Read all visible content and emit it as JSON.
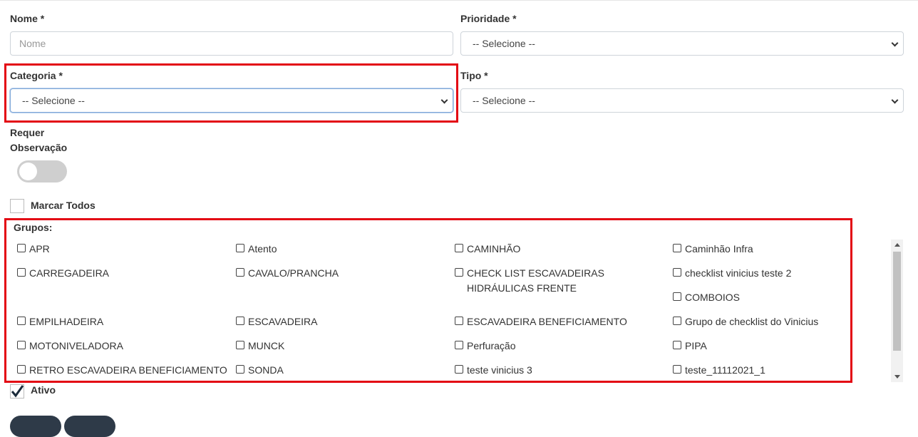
{
  "form": {
    "nome_label": "Nome *",
    "nome_placeholder": "Nome",
    "prioridade_label": "Prioridade *",
    "prioridade_value": "-- Selecione --",
    "categoria_label": "Categoria *",
    "categoria_value": "-- Selecione --",
    "tipo_label": "Tipo *",
    "tipo_value": "-- Selecione --",
    "requer_label_line1": "Requer",
    "requer_label_line2": "Observação",
    "requer_observacao_on": false,
    "marcar_todos_label": "Marcar Todos",
    "marcar_todos_checked": false,
    "grupos_label": "Grupos:",
    "ativo_label": "Ativo",
    "ativo_checked": true
  },
  "groups": [
    {
      "label": "APR",
      "checked": false
    },
    {
      "label": "Atento",
      "checked": false
    },
    {
      "label": "CAMINHÃO",
      "checked": false
    },
    {
      "label": "Caminhão Infra",
      "checked": false
    },
    {
      "label": "CARREGADEIRA",
      "checked": false
    },
    {
      "label": "CAVALO/PRANCHA",
      "checked": false
    },
    {
      "label": "CHECK LIST ESCAVADEIRAS HIDRÁULICAS FRENTE",
      "checked": false
    },
    {
      "label": "checklist vinicius teste 2",
      "checked": false
    },
    {
      "label": "COMBOIOS",
      "checked": false
    },
    {
      "label": "EMPILHADEIRA",
      "checked": false
    },
    {
      "label": "ESCAVADEIRA",
      "checked": false
    },
    {
      "label": "ESCAVADEIRA BENEFICIAMENTO",
      "checked": false
    },
    {
      "label": "Grupo de checklist do Vinicius",
      "checked": false
    },
    {
      "label": "MOTONIVELADORA",
      "checked": false
    },
    {
      "label": "MUNCK",
      "checked": false
    },
    {
      "label": "Perfuração",
      "checked": false
    },
    {
      "label": "PIPA",
      "checked": false
    },
    {
      "label": "RETRO ESCAVADEIRA BENEFICIAMENTO",
      "checked": false
    },
    {
      "label": "SONDA",
      "checked": false
    },
    {
      "label": "teste vinicius 3",
      "checked": false
    },
    {
      "label": "teste_11112021_1",
      "checked": false
    }
  ],
  "colors": {
    "highlight": "#e30613",
    "button": "#2e3a48"
  }
}
